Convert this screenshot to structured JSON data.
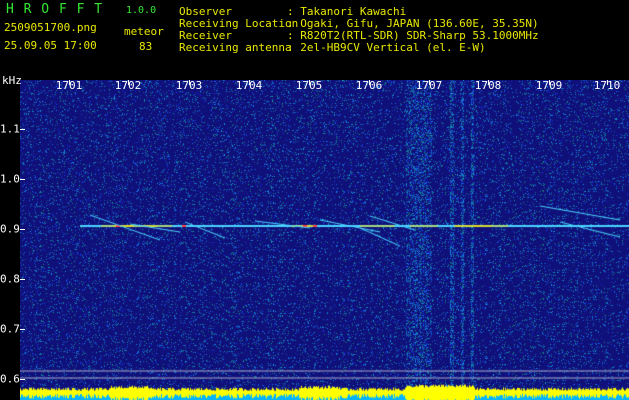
{
  "header": {
    "app_name": "H R O F F T",
    "version": "1.0.0",
    "filename": "2509051700.png",
    "datetime": "25.09.05 17:00",
    "meteor_label": "meteor",
    "meteor_count": "83"
  },
  "info": {
    "observer_key": "Observer",
    "observer_val": ": Takanori Kawachi",
    "location_key": "Receiving Location",
    "location_val": ": Ogaki, Gifu, JAPAN (136.60E, 35.35N)",
    "receiver_key": "Receiver",
    "receiver_val": ": R820T2(RTL-SDR) SDR-Sharp 53.1000MHz",
    "antenna_key": "Receiving antenna",
    "antenna_val": ": 2el-HB9CV Vertical (el. E-W)"
  },
  "axis": {
    "y_unit": "kHz",
    "x_ticks": [
      "1701",
      "1702",
      "1703",
      "1704",
      "1705",
      "1706",
      "1707",
      "1708",
      "1709",
      "1710"
    ],
    "y_ticks": [
      "1.1",
      "1.0",
      "0.9",
      "0.8",
      "0.7",
      "0.6"
    ]
  },
  "colors": {
    "background": "#10107a",
    "trace": "#4ad4ff",
    "signal": "#ffe000",
    "amplitude_bars": "#ffff00",
    "baseline": "#00b4ff"
  }
}
